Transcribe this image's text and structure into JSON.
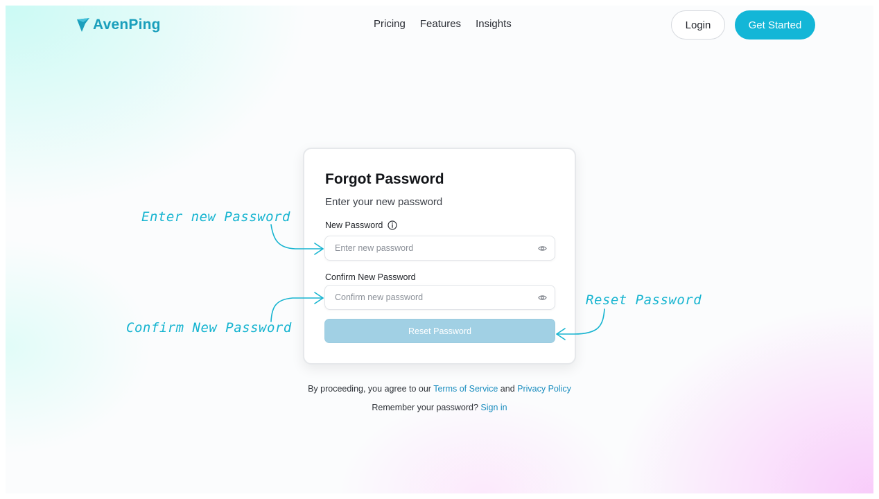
{
  "header": {
    "logo_text": "AvenPing",
    "nav": [
      "Pricing",
      "Features",
      "Insights"
    ],
    "login_label": "Login",
    "get_started_label": "Get Started"
  },
  "card": {
    "title": "Forgot Password",
    "subtitle": "Enter your new password",
    "new_password_label": "New Password",
    "new_password_placeholder": "Enter new password",
    "new_password_value": "",
    "confirm_label": "Confirm New Password",
    "confirm_placeholder": "Confirm new password",
    "confirm_value": "",
    "reset_label": "Reset Password"
  },
  "footer": {
    "terms_prefix": "By proceeding, you agree to our ",
    "terms_link": "Terms of Service",
    "terms_and": " and ",
    "privacy_link": "Privacy Policy",
    "remember_prefix": "Remember your password? ",
    "signin_link": "Sign in"
  },
  "annotations": {
    "enter_new": "Enter new Password",
    "confirm_new": "Confirm New Password",
    "reset": "Reset Password"
  },
  "colors": {
    "brand": "#1a9fbc",
    "primary_button": "#13b6d7",
    "reset_button_disabled": "#a1d0e4",
    "link": "#1c8ebf",
    "annotation": "#16b4d0"
  },
  "icons": {
    "logo": "avenping-logo-icon",
    "info": "info-icon",
    "eye": "eye-icon"
  }
}
